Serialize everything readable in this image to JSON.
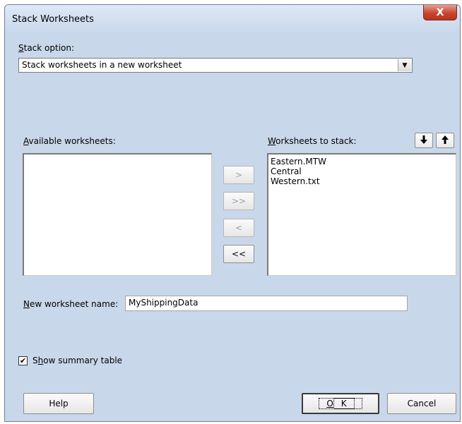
{
  "window": {
    "title": "Stack Worksheets",
    "close_glyph": "X"
  },
  "stack_option": {
    "label_accel": "S",
    "label_rest": "tack option:",
    "value": "Stack worksheets in a new worksheet"
  },
  "available": {
    "label_accel": "A",
    "label_rest": "vailable worksheets:",
    "items": []
  },
  "to_stack": {
    "label_accel": "W",
    "label_rest": "orksheets to stack:",
    "items": [
      "Eastern.MTW",
      "Central",
      "Western.txt"
    ]
  },
  "move_buttons": {
    "add_one": ">",
    "add_all": ">>",
    "remove_one": "<",
    "remove_all": "<<"
  },
  "order_buttons": {
    "down_glyph": "🡣",
    "up_glyph": "🡡"
  },
  "new_name": {
    "label_accel": "N",
    "label_rest": "ew worksheet name:",
    "value": "MyShippingData"
  },
  "summary": {
    "label_prefix": "S",
    "label_accel": "h",
    "label_rest": "ow summary table",
    "checked": true,
    "check_glyph": "✔"
  },
  "footer": {
    "help": "Help",
    "ok_accel": "O",
    "ok_rest": "K",
    "cancel": "Cancel"
  }
}
